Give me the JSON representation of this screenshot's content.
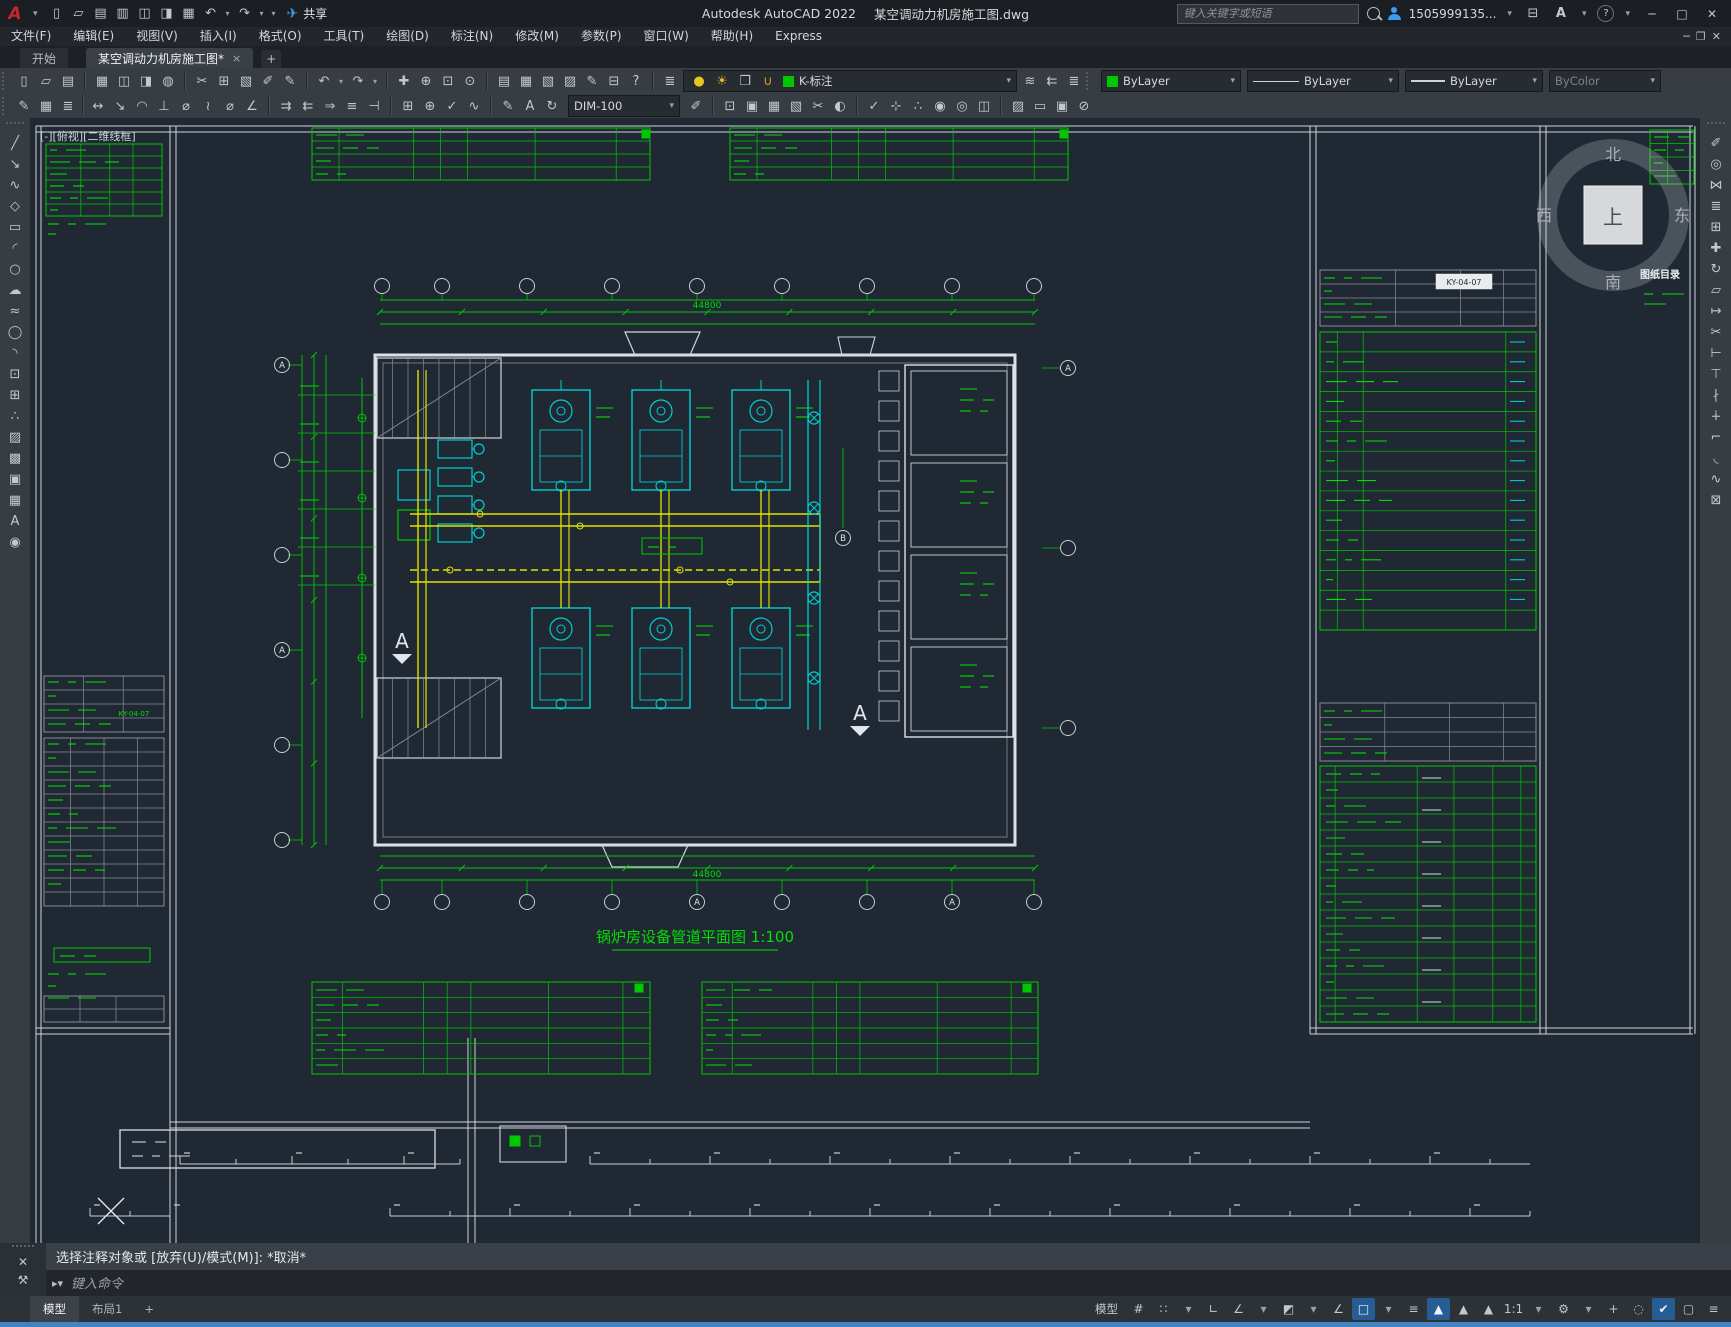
{
  "window": {
    "logo_letter": "A",
    "app_title": "Autodesk AutoCAD 2022",
    "doc_title": "某空调动力机房施工图.dwg",
    "search_placeholder": "键入关键字或短语",
    "user_id": "1505999135...",
    "share_label": "共享",
    "minimize": "─",
    "maximize": "□",
    "close": "✕",
    "doc_restore": "❐"
  },
  "menus": [
    "文件(F)",
    "编辑(E)",
    "视图(V)",
    "插入(I)",
    "格式(O)",
    "工具(T)",
    "绘图(D)",
    "标注(N)",
    "修改(M)",
    "参数(P)",
    "窗口(W)",
    "帮助(H)",
    "Express"
  ],
  "file_tabs": {
    "start": "开始",
    "active": "某空调动力机房施工图*",
    "close_glyph": "×",
    "add_glyph": "+"
  },
  "toolbar": {
    "layer_value": "K-标注",
    "color_value": "ByLayer",
    "linetype_value": "ByLayer",
    "lineweight_value": "ByLayer",
    "plotstyle_value": "ByColor",
    "dimstyle_value": "DIM-100"
  },
  "drawing": {
    "viewport_controls": "[-][俯视][二维线框]",
    "plan_title": "锅炉房设备管道平面图  1:100",
    "dim_top_total": "44800",
    "dim_bottom_total": "44800",
    "axis_a": "A",
    "axis_b": "B",
    "section_mark": "A",
    "doc_code": "KY-04-07",
    "right_list_heading": "图纸目录",
    "viewcube": {
      "up": "上",
      "north": "北",
      "south": "南",
      "east": "东",
      "west": "西"
    }
  },
  "command": {
    "history": "选择注释对象或 [放弃(U)/模式(M)]: *取消*",
    "input_placeholder": "键入命令"
  },
  "layout_tabs": {
    "model": "模型",
    "layout1": "布局1",
    "add": "+"
  },
  "status": {
    "model_label": "模型",
    "anno_scale": "1:1"
  },
  "colors": {
    "accent_blue": "#3f85c6",
    "cad_green": "#00dd00",
    "cad_cyan": "#00dddd",
    "cad_yellow": "#e8e800",
    "sheet_white": "#d9dde1",
    "canvas_bg": "#1f2833"
  },
  "icons": {
    "qat": [
      {
        "n": "new-file-icon",
        "g": "▯"
      },
      {
        "n": "open-folder-icon",
        "g": "▱"
      },
      {
        "n": "save-icon",
        "g": "▤"
      },
      {
        "n": "save-as-icon",
        "g": "▥"
      },
      {
        "n": "open-from-mobile-icon",
        "g": "◫"
      },
      {
        "n": "save-to-mobile-icon",
        "g": "◨"
      },
      {
        "n": "print-icon",
        "g": "▦"
      },
      {
        "n": "undo-icon",
        "g": "↶"
      },
      {
        "n": "undo-dropdown-icon",
        "g": "▾",
        "cls": "drop"
      },
      {
        "n": "redo-icon",
        "g": "↷"
      },
      {
        "n": "redo-dropdown-icon",
        "g": "▾",
        "cls": "drop"
      },
      {
        "n": "qat-customize-icon",
        "g": "▾",
        "cls": "drop"
      }
    ],
    "std": [
      {
        "n": "new-file-icon",
        "g": "▯"
      },
      {
        "n": "open-folder-icon",
        "g": "▱"
      },
      {
        "n": "save-icon",
        "g": "▤"
      },
      {
        "sep": true
      },
      {
        "n": "print-icon",
        "g": "▦"
      },
      {
        "n": "plot-preview-icon",
        "g": "◫"
      },
      {
        "n": "publish-icon",
        "g": "◨"
      },
      {
        "n": "web-publish-icon",
        "g": "◍"
      },
      {
        "sep": true
      },
      {
        "n": "cut-icon",
        "g": "✂"
      },
      {
        "n": "copy-icon",
        "g": "⊞"
      },
      {
        "n": "paste-icon",
        "g": "▧"
      },
      {
        "n": "match-cell-icon",
        "g": "✐"
      },
      {
        "n": "match-properties-icon",
        "g": "✎"
      },
      {
        "sep": true
      },
      {
        "n": "undo-icon",
        "g": "↶"
      },
      {
        "n": "undo-dropdown-icon",
        "g": "▾",
        "cls": "drop"
      },
      {
        "n": "redo-icon",
        "g": "↷"
      },
      {
        "n": "redo-dropdown-icon",
        "g": "▾",
        "cls": "drop"
      },
      {
        "sep": true
      },
      {
        "n": "pan-icon",
        "g": "✚"
      },
      {
        "n": "zoom-realtime-icon",
        "g": "⊕"
      },
      {
        "n": "zoom-window-icon",
        "g": "⊡"
      },
      {
        "n": "zoom-previous-icon",
        "g": "⊙"
      },
      {
        "sep": true
      },
      {
        "n": "properties-palette-icon",
        "g": "▤"
      },
      {
        "n": "designcenter-icon",
        "g": "▦"
      },
      {
        "n": "tool-palettes-icon",
        "g": "▧"
      },
      {
        "n": "sheet-set-manager-icon",
        "g": "▨"
      },
      {
        "n": "markup-icon",
        "g": "✎"
      },
      {
        "n": "quickcalc-icon",
        "g": "⊟"
      },
      {
        "n": "help-icon",
        "g": "?"
      },
      {
        "sep": true
      },
      {
        "n": "layer-properties-icon",
        "g": "≣"
      }
    ],
    "layer_combo": [
      {
        "n": "layer-on-icon",
        "g": "●",
        "cls": "yel"
      },
      {
        "n": "layer-thaw-icon",
        "g": "☀",
        "cls": "yel"
      },
      {
        "n": "layer-vpfreeze-icon",
        "g": "❐"
      },
      {
        "n": "layer-unlock-icon",
        "g": "∪",
        "cls": "org"
      }
    ],
    "layer_tools": [
      {
        "n": "layer-make-current-icon",
        "g": "≋"
      },
      {
        "n": "layer-previous-icon",
        "g": "⇇"
      },
      {
        "n": "layer-states-icon",
        "g": "≣"
      }
    ],
    "tb2_left": [
      {
        "n": "dim-style-manager-icon",
        "g": "✎"
      },
      {
        "n": "text-style-icon",
        "g": "▦"
      },
      {
        "n": "layer-translate-icon",
        "g": "≣"
      }
    ],
    "dims": [
      {
        "n": "dim-linear-icon",
        "g": "↔"
      },
      {
        "n": "dim-aligned-icon",
        "g": "↘"
      },
      {
        "n": "dim-arclength-icon",
        "g": "◠"
      },
      {
        "n": "dim-ordinate-icon",
        "g": "⊥"
      },
      {
        "n": "dim-radius-icon",
        "g": "⌀"
      },
      {
        "n": "dim-jogged-icon",
        "g": "≀"
      },
      {
        "n": "dim-diameter-icon",
        "g": "⌀"
      },
      {
        "n": "dim-angular-icon",
        "g": "∠"
      },
      {
        "sep": true
      },
      {
        "n": "quick-dimension-icon",
        "g": "⇉"
      },
      {
        "n": "dim-baseline-icon",
        "g": "⇇"
      },
      {
        "n": "dim-continue-icon",
        "g": "⇒"
      },
      {
        "n": "dim-space-icon",
        "g": "≡"
      },
      {
        "n": "dim-break-icon",
        "g": "⊣"
      },
      {
        "sep": true
      },
      {
        "n": "tolerance-icon",
        "g": "⊞"
      },
      {
        "n": "center-mark-icon",
        "g": "⊕"
      },
      {
        "n": "dim-inspect-icon",
        "g": "✓"
      },
      {
        "n": "dim-jogline-icon",
        "g": "∿"
      },
      {
        "sep": true
      },
      {
        "n": "dim-edit-icon",
        "g": "✎"
      },
      {
        "n": "dim-text-edit-icon",
        "g": "A"
      },
      {
        "n": "dim-update-icon",
        "g": "↻"
      }
    ],
    "tb2_right": [
      {
        "n": "dim-style-apply-icon",
        "g": "✐"
      },
      {
        "sep": true
      },
      {
        "n": "insert-block-icon",
        "g": "⊡"
      },
      {
        "n": "external-reference-icon",
        "g": "▣"
      },
      {
        "n": "raster-image-icon",
        "g": "▦"
      },
      {
        "n": "underlay-icon",
        "g": "▧"
      },
      {
        "n": "clip-icon",
        "g": "✂"
      },
      {
        "n": "adjust-icon",
        "g": "◐"
      },
      {
        "sep": true
      },
      {
        "n": "quick-select-icon",
        "g": "✓"
      },
      {
        "n": "measure-icon",
        "g": "⊹"
      },
      {
        "n": "point-style-icon",
        "g": "∴"
      },
      {
        "n": "group-icon",
        "g": "◉"
      },
      {
        "n": "ungroup-icon",
        "g": "◎"
      },
      {
        "n": "draw-order-icon",
        "g": "◫"
      },
      {
        "sep": true
      },
      {
        "n": "hatch-edit-icon",
        "g": "▨"
      },
      {
        "n": "boundary-icon",
        "g": "▭"
      },
      {
        "n": "region-icon",
        "g": "▣"
      },
      {
        "n": "purge-icon",
        "g": "⊘"
      }
    ],
    "draw": [
      {
        "n": "line-icon",
        "g": "╱"
      },
      {
        "n": "construction-line-icon",
        "g": "↘"
      },
      {
        "n": "polyline-icon",
        "g": "∿"
      },
      {
        "n": "polygon-icon",
        "g": "◇"
      },
      {
        "n": "rectangle-icon",
        "g": "▭"
      },
      {
        "n": "arc-icon",
        "g": "◜"
      },
      {
        "n": "circle-icon",
        "g": "○"
      },
      {
        "n": "revcloud-icon",
        "g": "☁"
      },
      {
        "n": "spline-icon",
        "g": "≈"
      },
      {
        "n": "ellipse-icon",
        "g": "◯"
      },
      {
        "n": "ellipse-arc-icon",
        "g": "◝"
      },
      {
        "n": "insert-block-icon",
        "g": "⊡"
      },
      {
        "n": "make-block-icon",
        "g": "⊞"
      },
      {
        "n": "point-icon",
        "g": "∴"
      },
      {
        "n": "hatch-icon",
        "g": "▨"
      },
      {
        "n": "gradient-icon",
        "g": "▩"
      },
      {
        "n": "region-icon",
        "g": "▣"
      },
      {
        "n": "table-icon",
        "g": "▦"
      },
      {
        "n": "mtext-icon",
        "g": "A"
      },
      {
        "n": "group-icon",
        "g": "◉"
      }
    ],
    "modify": [
      {
        "n": "erase-icon",
        "g": "✐"
      },
      {
        "n": "copy-icon",
        "g": "◎"
      },
      {
        "n": "mirror-icon",
        "g": "⋈"
      },
      {
        "n": "offset-icon",
        "g": "≣"
      },
      {
        "n": "array-icon",
        "g": "⊞"
      },
      {
        "n": "move-icon",
        "g": "✚"
      },
      {
        "n": "rotate-icon",
        "g": "↻"
      },
      {
        "n": "scale-icon",
        "g": "▱"
      },
      {
        "n": "stretch-icon",
        "g": "↦"
      },
      {
        "n": "trim-icon",
        "g": "✂"
      },
      {
        "n": "extend-icon",
        "g": "⊢"
      },
      {
        "n": "break-at-point-icon",
        "g": "⊤"
      },
      {
        "n": "break-icon",
        "g": "∤"
      },
      {
        "n": "join-icon",
        "g": "∔"
      },
      {
        "n": "chamfer-icon",
        "g": "⌐"
      },
      {
        "n": "fillet-icon",
        "g": "◟"
      },
      {
        "n": "blend-curves-icon",
        "g": "∿"
      },
      {
        "n": "explode-icon",
        "g": "⊠"
      }
    ],
    "status": [
      {
        "n": "grid-display-icon",
        "g": "#"
      },
      {
        "n": "snap-mode-icon",
        "g": "∷"
      },
      {
        "n": "snap-dropdown-icon",
        "g": "▾",
        "cls": "drop"
      },
      {
        "n": "ortho-mode-icon",
        "g": "∟"
      },
      {
        "n": "polar-tracking-icon",
        "g": "∠"
      },
      {
        "n": "polar-dropdown-icon",
        "g": "▾",
        "cls": "drop"
      },
      {
        "n": "isometric-drafting-icon",
        "g": "◩"
      },
      {
        "n": "isodraft-dropdown-icon",
        "g": "▾",
        "cls": "drop"
      },
      {
        "n": "object-snap-tracking-icon",
        "g": "∠"
      },
      {
        "n": "object-snap-icon",
        "g": "□",
        "cls": "hl"
      },
      {
        "n": "osnap-dropdown-icon",
        "g": "▾",
        "cls": "drop"
      },
      {
        "n": "lineweight-display-icon",
        "g": "≡"
      },
      {
        "n": "annotation-visibility-icon",
        "g": "▲",
        "cls": "hl"
      },
      {
        "n": "annotation-autoscale-icon",
        "g": "▲"
      },
      {
        "n": "annotation-scale-icon",
        "g": "▲"
      },
      {
        "t": "status.anno_scale",
        "n": "annotation-scale-value"
      },
      {
        "n": "scale-dropdown-icon",
        "g": "▾",
        "cls": "drop"
      },
      {
        "n": "workspace-switching-icon",
        "g": "⚙"
      },
      {
        "n": "workspace-dropdown-icon",
        "g": "▾",
        "cls": "drop"
      },
      {
        "n": "tracking-icon",
        "g": "+"
      },
      {
        "n": "isolate-objects-icon",
        "g": "◌"
      },
      {
        "n": "graphics-performance-icon",
        "g": "✔",
        "cls": "hl"
      },
      {
        "n": "clean-screen-icon",
        "g": "▢"
      },
      {
        "n": "customization-menu-icon",
        "g": "≡"
      }
    ]
  }
}
